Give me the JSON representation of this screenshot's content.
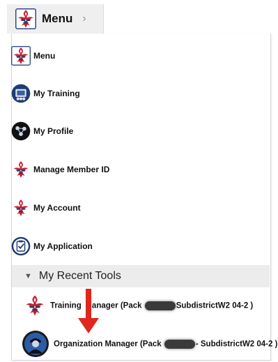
{
  "menu_tab": {
    "title": "Menu",
    "chevron": "›"
  },
  "menu_items": [
    {
      "label": "Menu",
      "icon": "scouting-emblem-icon"
    },
    {
      "label": "My Training",
      "icon": "training-icon"
    },
    {
      "label": "My Profile",
      "icon": "profile-icon"
    },
    {
      "label": "Manage Member ID",
      "icon": "scouting-emblem-icon"
    },
    {
      "label": "My Account",
      "icon": "scouting-emblem-icon"
    },
    {
      "label": "My Application",
      "icon": "application-checklist-icon"
    }
  ],
  "recent_tools": {
    "title": "My Recent Tools",
    "items": [
      {
        "label_before": "Training ",
        "label_middle": "anager (Pack ",
        "label_after": "SubdistrictW2 04-2 )",
        "icon": "scouting-emblem-icon"
      },
      {
        "label_before": "Organization Manager (Pack ",
        "label_after": "- SubdistrictW2 04-2 )",
        "icon": "organization-manager-icon"
      }
    ]
  },
  "colors": {
    "scout_red": "#c8202f",
    "scout_blue": "#1f3b73",
    "arrow_red": "#e0261d"
  }
}
